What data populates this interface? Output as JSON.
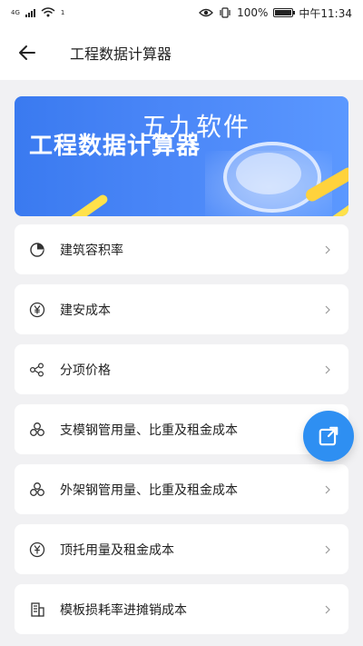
{
  "status_bar": {
    "network_label": "4G",
    "wifi_label": "1",
    "battery_text": "100%",
    "time": "中午11:34"
  },
  "header": {
    "title": "工程数据计算器"
  },
  "banner": {
    "title": "工程数据计算器",
    "watermark": "五九软件"
  },
  "items": [
    {
      "label": "建筑容积率",
      "icon": "pie-chart-icon"
    },
    {
      "label": "建安成本",
      "icon": "yen-icon"
    },
    {
      "label": "分项价格",
      "icon": "nodes-icon"
    },
    {
      "label": "支模钢管用量、比重及租金成本",
      "icon": "triad-circles-icon"
    },
    {
      "label": "外架钢管用量、比重及租金成本",
      "icon": "triad-circles-icon"
    },
    {
      "label": "顶托用量及租金成本",
      "icon": "yen-shield-icon"
    },
    {
      "label": "模板损耗率进摊销成本",
      "icon": "building-icon"
    }
  ],
  "colors": {
    "accent": "#2e8ff2",
    "banner_start": "#3a7af0",
    "banner_end": "#5b98ff",
    "background": "#f1f1f3"
  }
}
